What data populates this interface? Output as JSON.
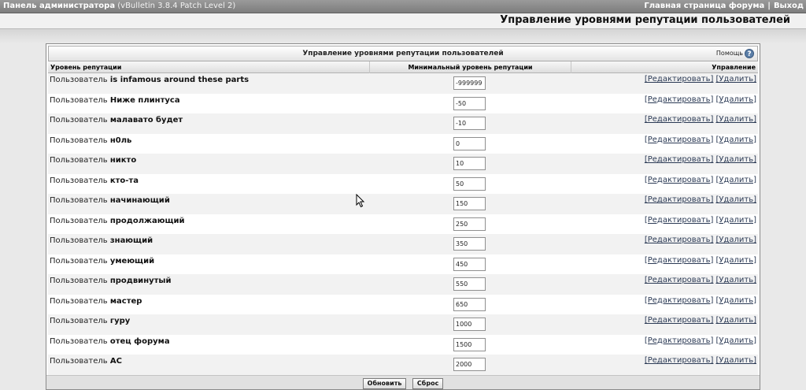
{
  "topbar": {
    "title": "Панель администратора",
    "version": "(vBulletin 3.8.4 Patch Level 2)",
    "forum_home": "Главная страница форума",
    "separator": "|",
    "logout": "Выход"
  },
  "page": {
    "heading": "Управление уровнями репутации пользователей"
  },
  "panel": {
    "title": "Управление уровнями репутации пользователей",
    "help_label": "Помощь",
    "help_icon": "?",
    "columns": {
      "level": "Уровень репутации",
      "min": "Минимальный уровень репутации",
      "manage": "Управление"
    },
    "row_prefix": "Пользователь",
    "edit_label": "[Редактировать]",
    "delete_label": "[Удалить]",
    "rows": [
      {
        "name": "is infamous around these parts",
        "min": "-999999"
      },
      {
        "name": "Ниже плинтуса",
        "min": "-50"
      },
      {
        "name": "малавато будет",
        "min": "-10"
      },
      {
        "name": "н0ль",
        "min": "0"
      },
      {
        "name": "никто",
        "min": "10"
      },
      {
        "name": "кто-та",
        "min": "50"
      },
      {
        "name": "начинающий",
        "min": "150"
      },
      {
        "name": "продолжающий",
        "min": "250"
      },
      {
        "name": "знающий",
        "min": "350"
      },
      {
        "name": "умеющий",
        "min": "450"
      },
      {
        "name": "продвинутый",
        "min": "550"
      },
      {
        "name": "мастер",
        "min": "650"
      },
      {
        "name": "гуру",
        "min": "1000"
      },
      {
        "name": "отец форума",
        "min": "1500"
      },
      {
        "name": "AC",
        "min": "2000"
      }
    ],
    "update_button": "Обновить",
    "reset_button": "Сброс"
  }
}
